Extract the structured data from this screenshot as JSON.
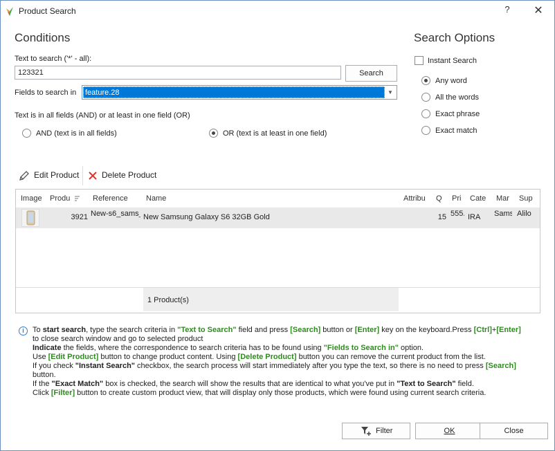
{
  "window": {
    "title": "Product Search",
    "help": "?",
    "close": "✕"
  },
  "conditions": {
    "heading": "Conditions",
    "text_label": "Text to search ('*' - all):",
    "text_value": "123321",
    "search_button": "Search",
    "fields_label": "Fields to search in",
    "fields_value": "feature.28",
    "logic_label": "Text is in all fields (AND) or at least in one field (OR)",
    "and_label": "AND (text is in all fields)",
    "or_label": "OR (text is at least in one field)",
    "selected_logic": "OR"
  },
  "options": {
    "heading": "Search Options",
    "instant_label": "Instant Search",
    "instant_checked": false,
    "modes": [
      "Any word",
      "All the words",
      "Exact phrase",
      "Exact match"
    ],
    "selected_mode": "Any word"
  },
  "toolbar": {
    "edit_label": "Edit Product",
    "delete_label": "Delete Product"
  },
  "grid": {
    "columns": [
      "Image",
      "Produ",
      "Reference",
      "Name",
      "Attribu",
      "Q",
      "Pri",
      "Cate",
      "Mar",
      "Sup"
    ],
    "rows": [
      {
        "id": "3921",
        "reference": "New-s6_sams_",
        "name": "New Samsung Galaxy S6 32GB Gold",
        "qty": "15",
        "price": "555.",
        "category": "IRA",
        "manufacturer": "Sams",
        "supplier": "Alilo"
      }
    ],
    "footer": "1 Product(s)"
  },
  "info": {
    "icon": "i",
    "lines": [
      [
        [
          "",
          "To "
        ],
        [
          "b",
          "start search"
        ],
        [
          "",
          ", type the search criteria in "
        ],
        [
          "g",
          "\"Text to Search\""
        ],
        [
          "",
          " field and press "
        ],
        [
          "g",
          "[Search]"
        ],
        [
          "",
          " button or "
        ],
        [
          "g",
          "[Enter]"
        ],
        [
          "",
          " key on the keyboard.Press "
        ],
        [
          "g",
          "[Ctrl]"
        ],
        [
          "",
          "+"
        ],
        [
          "g",
          "[Enter]"
        ]
      ],
      [
        [
          "",
          "to close search window and go to selected product"
        ]
      ],
      [
        [
          "b",
          "Indicate"
        ],
        [
          "",
          " the fields, where the correspondence to search criteria has to be found using "
        ],
        [
          "g",
          "\"Fields to Search in\""
        ],
        [
          "",
          " option."
        ]
      ],
      [
        [
          "",
          "Use "
        ],
        [
          "g",
          "[Edit Product]"
        ],
        [
          "",
          " button to change product content. Using "
        ],
        [
          "g",
          "[Delete Product]"
        ],
        [
          "",
          " button you can remove the current product from the list."
        ]
      ],
      [
        [
          "",
          "If you check "
        ],
        [
          "b",
          "\"Instant Search\""
        ],
        [
          "",
          " checkbox, the search process will start immediately after you type the text, so there is no need to press "
        ],
        [
          "g",
          "[Search]"
        ]
      ],
      [
        [
          "",
          "button."
        ]
      ],
      [
        [
          "",
          "If the "
        ],
        [
          "b",
          "\"Exact Match\""
        ],
        [
          "",
          " box is checked, the search will show the results that are identical to what you've put in "
        ],
        [
          "b",
          "\"Text to Search\""
        ],
        [
          "",
          " field."
        ]
      ],
      [
        [
          "",
          "Click "
        ],
        [
          "g",
          "[Filter]"
        ],
        [
          "",
          " button to create custom product view, that will display only those products, which were found using current search criteria."
        ]
      ]
    ]
  },
  "buttons": {
    "filter": "Filter",
    "ok": "OK",
    "close": "Close"
  },
  "colors": {
    "selection": "#0078d7",
    "accent_green": "#2e8b1e",
    "delete_red": "#e0322e",
    "info_blue": "#2a7fd4"
  }
}
